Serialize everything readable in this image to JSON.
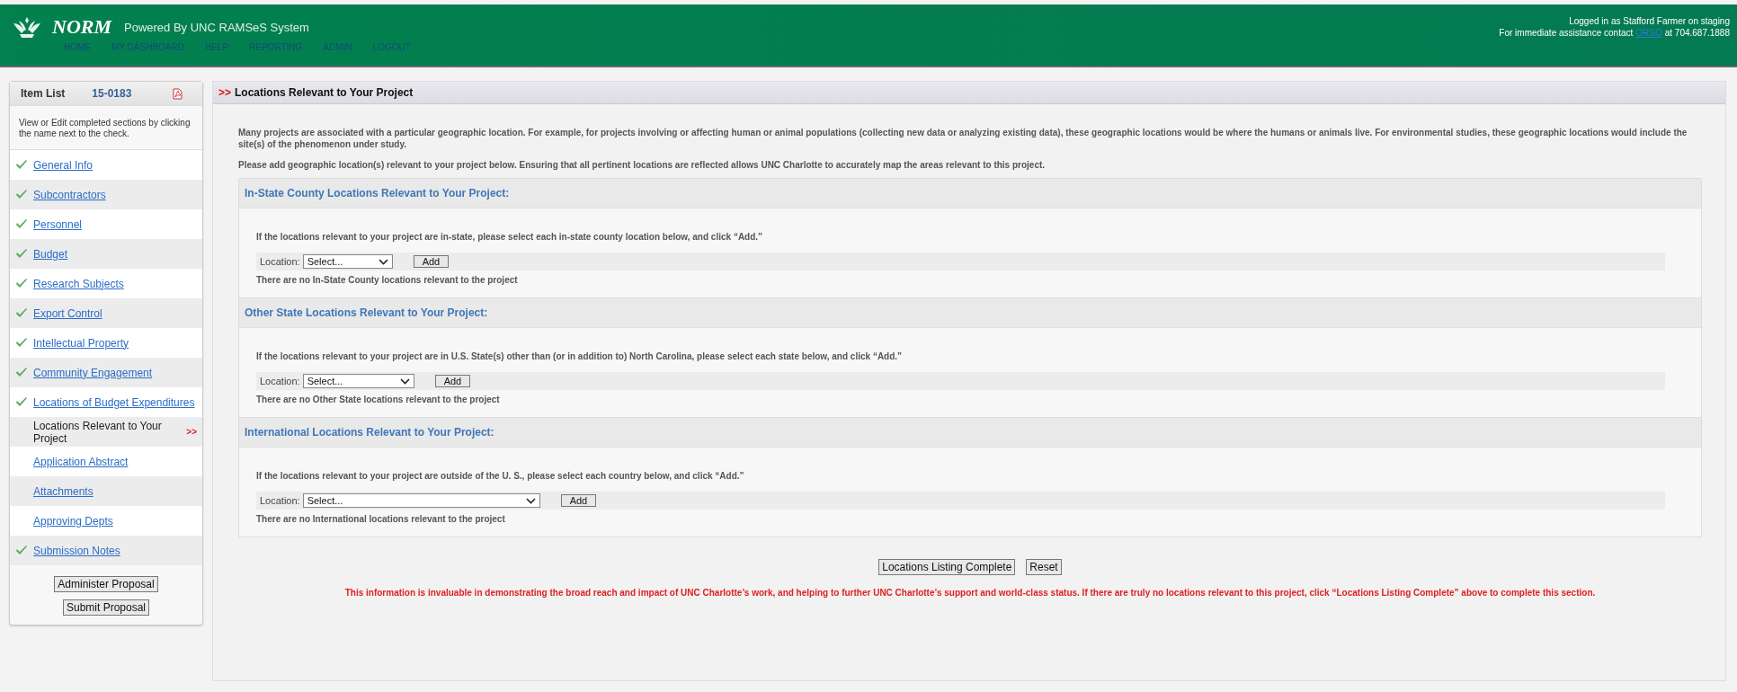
{
  "header": {
    "app_name": "NORM",
    "tagline": "Powered By UNC RAMSeS System",
    "nav": [
      "HOME",
      "MY DASHBOARD",
      "HELP",
      "REPORTING",
      "ADMIN",
      "LOGOUT"
    ],
    "login_text": "Logged in as Stafford Farmer on staging",
    "assist_prefix": "For immediate assistance contact",
    "assist_link": "ORSO",
    "assist_suffix": "at 704.687.1888"
  },
  "sidebar": {
    "title": "Item List",
    "proposal_number": "15-0183",
    "hint": "View or Edit completed sections by clicking the name next to the check.",
    "current_marker": ">>",
    "items": [
      {
        "label": "General Info",
        "checked": true,
        "selected": false
      },
      {
        "label": "Subcontractors",
        "checked": true,
        "selected": false
      },
      {
        "label": "Personnel",
        "checked": true,
        "selected": false
      },
      {
        "label": "Budget",
        "checked": true,
        "selected": false
      },
      {
        "label": "Research Subjects",
        "checked": true,
        "selected": false
      },
      {
        "label": "Export Control",
        "checked": true,
        "selected": false
      },
      {
        "label": "Intellectual Property",
        "checked": true,
        "selected": false
      },
      {
        "label": "Community Engagement",
        "checked": true,
        "selected": false
      },
      {
        "label": "Locations of Budget Expenditures",
        "checked": true,
        "selected": false
      },
      {
        "label": "Locations Relevant to Your Project",
        "checked": false,
        "selected": true
      },
      {
        "label": "Application Abstract",
        "checked": false,
        "selected": false
      },
      {
        "label": "Attachments",
        "checked": false,
        "selected": false
      },
      {
        "label": "Approving Depts",
        "checked": false,
        "selected": false
      },
      {
        "label": "Submission Notes",
        "checked": true,
        "selected": false
      }
    ],
    "buttons": [
      "Administer Proposal",
      "Submit Proposal"
    ]
  },
  "main": {
    "title_marker": ">>",
    "title": "Locations Relevant to Your Project",
    "intro": [
      "Many projects are associated with a particular geographic location. For example, for projects involving or affecting human or animal populations (collecting new data or analyzing existing data), these geographic locations would be where the humans or animals live. For environmental studies, these geographic locations would include the site(s) of the phenomenon under study.",
      "Please add geographic location(s) relevant to your project below. Ensuring that all pertinent locations are reflected allows UNC Charlotte to accurately map the areas relevant to this project."
    ],
    "sections": [
      {
        "heading": "In-State County Locations Relevant to Your Project:",
        "instruction": "If the locations relevant to your project are in-state, please select each in-state county location below, and click “Add.”",
        "field_label": "Location:",
        "select_value": "Select...",
        "add_button": "Add",
        "empty_message": "There are no In-State County locations relevant to the project"
      },
      {
        "heading": "Other State Locations Relevant to Your Project:",
        "instruction": "If the locations relevant to your project are in U.S. State(s) other than (or in addition to) North Carolina, please select each state below, and click “Add.”",
        "field_label": "Location:",
        "select_value": "Select...",
        "add_button": "Add",
        "empty_message": "There are no Other State locations relevant to the project"
      },
      {
        "heading": "International Locations Relevant to Your Project:",
        "instruction": "If the locations relevant to your project are outside of the U. S., please select each country below, and click “Add.”",
        "field_label": "Location:",
        "select_value": "Select...",
        "add_button": "Add",
        "empty_message": "There are no International locations relevant to the project"
      }
    ],
    "buttons": [
      "Locations Listing Complete",
      "Reset"
    ],
    "footer_note": "This information is invaluable in demonstrating the broad reach and impact of UNC Charlotte’s work, and helping to further UNC Charlotte’s support and world-class status. If there are truly no locations relevant to this project, click “Locations Listing Complete” above to complete this section."
  }
}
